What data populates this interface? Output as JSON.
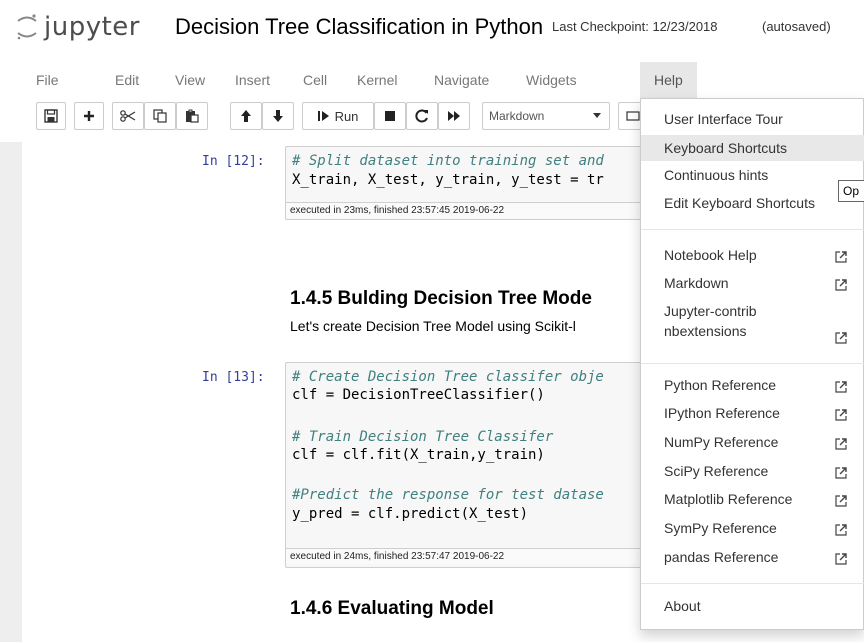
{
  "header": {
    "logo_text": "jupyter",
    "title": "Decision Tree Classification in Python",
    "checkpoint": "Last Checkpoint: 12/23/2018",
    "autosave": "(autosaved)"
  },
  "menubar": {
    "items": [
      "File",
      "Edit",
      "View",
      "Insert",
      "Cell",
      "Kernel",
      "Navigate",
      "Widgets",
      "Help"
    ]
  },
  "toolbar": {
    "run_label": "Run",
    "cell_type": "Markdown",
    "icons": [
      "save-icon",
      "plus-icon",
      "scissors-icon",
      "copy-icon",
      "paste-icon",
      "arrow-up-icon",
      "arrow-down-icon",
      "run-icon",
      "stop-icon",
      "restart-icon",
      "fast-forward-icon"
    ]
  },
  "cells": {
    "c12": {
      "prompt": "In [12]:",
      "lines": [
        "# Split dataset into training set and",
        "X_train, X_test, y_train, y_test = tr"
      ],
      "exec": "executed in 23ms, finished 23:57:45 2019-06-22"
    },
    "h145": "1.4.5  Bulding Decision Tree Mode",
    "p145": "Let's create Decision Tree Model using Scikit-l",
    "c13": {
      "prompt": "In [13]:",
      "lines": [
        "# Create Decision Tree classifer obje",
        "clf = DecisionTreeClassifier()",
        "",
        "# Train Decision Tree Classifer",
        "clf = clf.fit(X_train,y_train)",
        "",
        "#Predict the response for test datase",
        "y_pred = clf.predict(X_test)"
      ],
      "exec": "executed in 24ms, finished 23:57:47 2019-06-22"
    },
    "h146": "1.4.6  Evaluating Model"
  },
  "help_menu": {
    "items": [
      "User Interface Tour",
      "Keyboard Shortcuts",
      "Continuous hints",
      "Edit Keyboard Shortcuts",
      "Notebook Help",
      "Markdown",
      "Jupyter-contrib",
      "nbextensions",
      "Python Reference",
      "IPython Reference",
      "NumPy Reference",
      "SciPy Reference",
      "Matplotlib Reference",
      "SymPy Reference",
      "pandas Reference",
      "About"
    ],
    "highlighted": "Keyboard Shortcuts"
  },
  "tooltip": "Op",
  "colors": {
    "prompt": "#303f9f",
    "comment": "#408080",
    "menu_open_bg": "#e7e7e7",
    "highlight_bg": "#e8e8e8"
  }
}
